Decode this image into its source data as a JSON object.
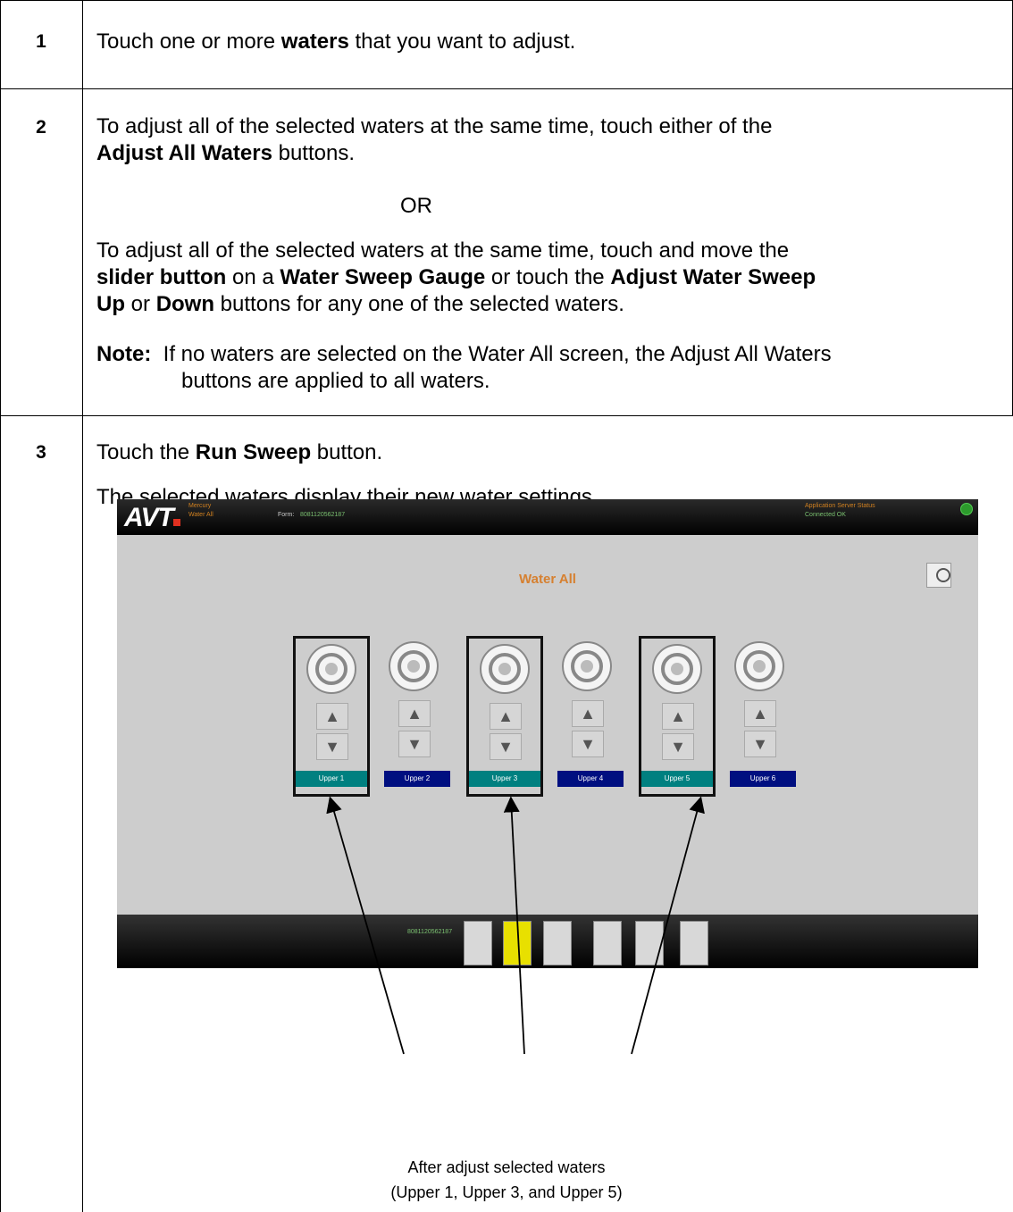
{
  "rows": [
    {
      "number": "1",
      "text": [
        "Touch one or more ",
        "waters",
        " that you want to adjust."
      ]
    },
    {
      "number": "2",
      "para1": [
        "To adjust all of the selected waters at the same time, touch either of the",
        "Adjust All Waters",
        " buttons."
      ],
      "or": "OR",
      "para2": [
        "To adjust all of the selected waters at the same time, touch and move the",
        "slider button",
        " on a ",
        "Water Sweep Gauge",
        " or touch the ",
        "Adjust Water Sweep",
        "Up",
        " or ",
        "Down",
        " buttons for any one of the selected waters."
      ],
      "note_label": "Note:",
      "note_text_1": "If no waters are selected on the Water All screen, the Adjust All Waters",
      "note_text_2": "buttons are applied to all waters."
    },
    {
      "number": "3",
      "line1": [
        "Touch the ",
        "Run Sweep",
        " button."
      ],
      "line2": "The selected waters display their new water settings."
    }
  ],
  "screen": {
    "logo": "AVT",
    "app_name_1": "Mercury",
    "app_name_2": "Water All",
    "form_label": "Form:",
    "form_value": "8081120562187",
    "status_1": "Application Server Status",
    "status_2": "Connected OK",
    "title": "Water All",
    "panels": [
      {
        "label": "Upper 1",
        "selected": true
      },
      {
        "label": "Upper 2",
        "selected": false
      },
      {
        "label": "Upper 3",
        "selected": true
      },
      {
        "label": "Upper 4",
        "selected": false
      },
      {
        "label": "Upper 5",
        "selected": true
      },
      {
        "label": "Upper 6",
        "selected": false
      }
    ],
    "up_glyph": "▲",
    "down_glyph": "▼",
    "bottom_form_value": "8081120562187"
  },
  "caption": {
    "line1": "After adjust selected waters",
    "line2": "(Upper 1, Upper 3, and Upper 5)"
  }
}
